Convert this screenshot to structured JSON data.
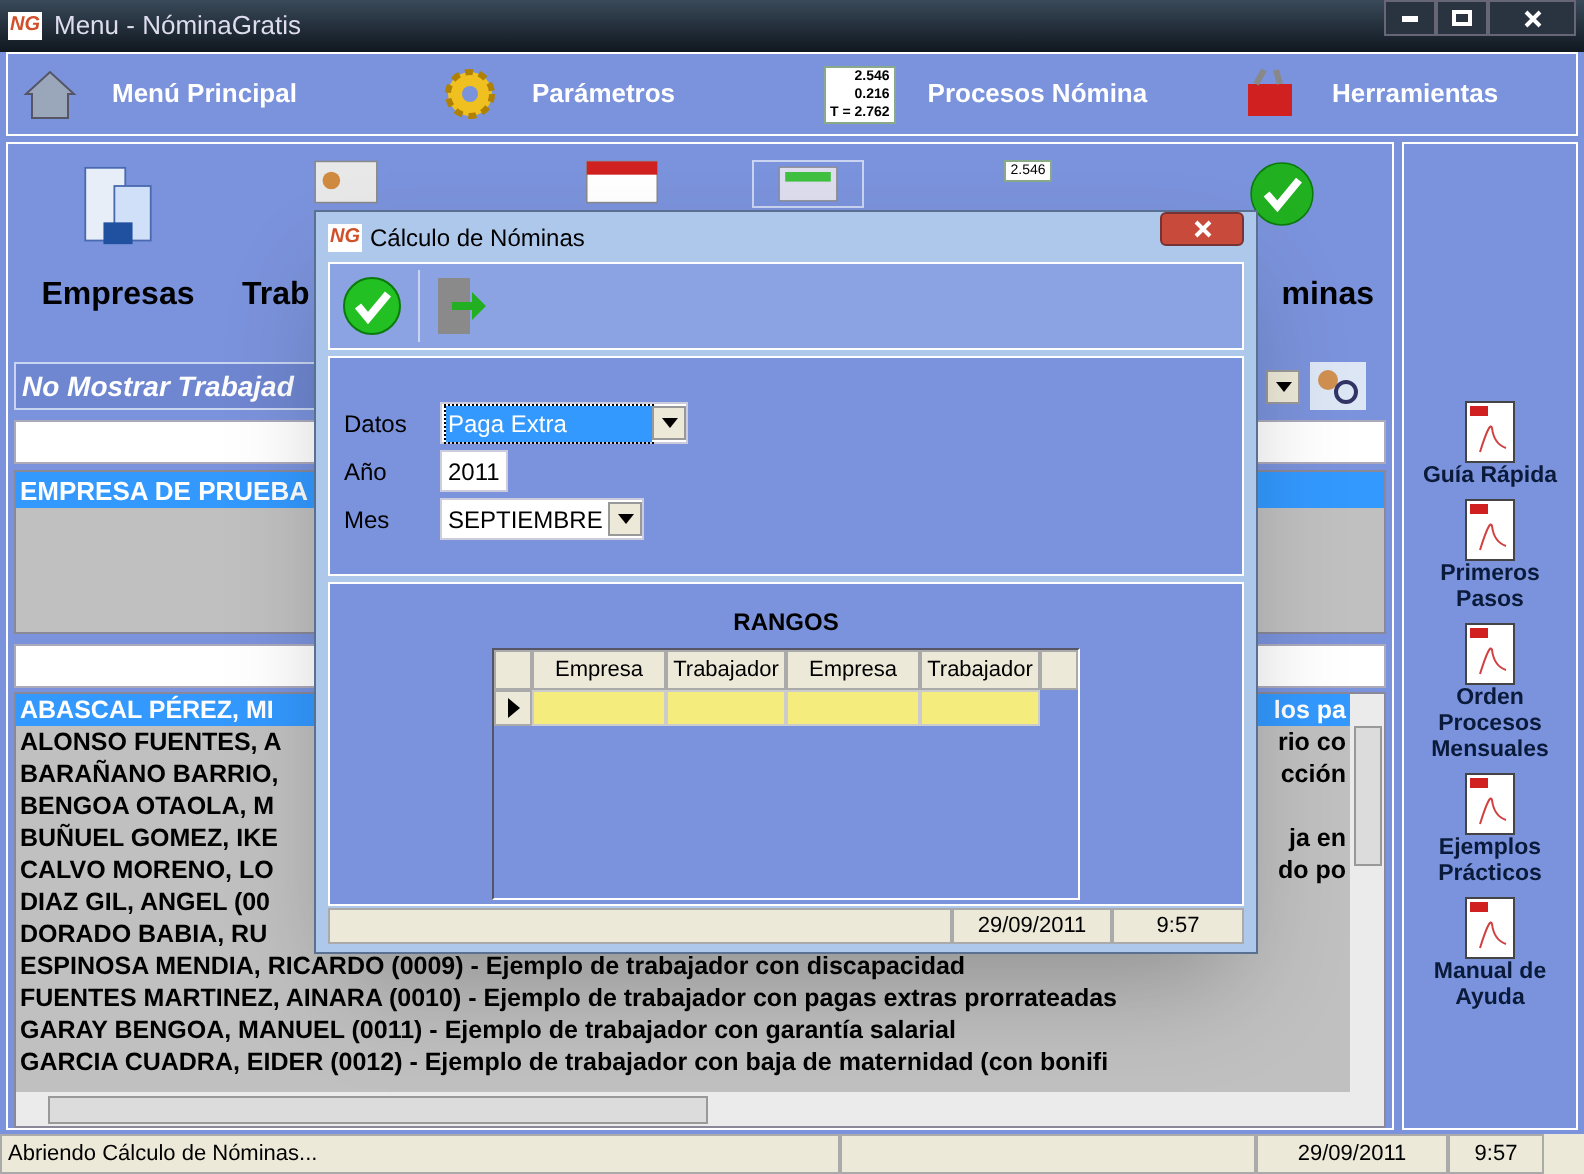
{
  "window": {
    "logo": "NG",
    "title": "Menu - NóminaGratis"
  },
  "menu": [
    {
      "kind": "home",
      "label": "Menú Principal"
    },
    {
      "kind": "gear",
      "label": "Parámetros"
    },
    {
      "kind": "sheet",
      "label": "Procesos Nómina",
      "icon_values": [
        "2.546",
        "0.216",
        "T = 2.762"
      ]
    },
    {
      "kind": "toolbox",
      "label": "Herramientas"
    }
  ],
  "modules": [
    {
      "kind": "building",
      "label": "Empresas"
    },
    {
      "kind": "card",
      "label": "Trab"
    },
    {
      "kind": "calendar"
    },
    {
      "kind": "calculator",
      "selected": true
    },
    {
      "kind": "sheet",
      "icon_value": "2.546"
    },
    {
      "kind": "check",
      "label": "minas"
    }
  ],
  "filter": {
    "value": "No Mostrar Trabajad"
  },
  "companies": [
    {
      "name": "EMPRESA DE PRUEBA",
      "selected": true
    }
  ],
  "workers": [
    {
      "left": "ABASCAL  PÉREZ, MI",
      "right": "los pa",
      "selected": true
    },
    {
      "left": "ALONSO  FUENTES, A",
      "right": "rio co",
      "selected": false
    },
    {
      "left": "BARAÑANO  BARRIO,",
      "right": "cción",
      "selected": false
    },
    {
      "left": "BENGOA  OTAOLA, M",
      "selected": false
    },
    {
      "left": "BUÑUEL  GOMEZ, IKE",
      "right": "ja en",
      "selected": false
    },
    {
      "left": "CALVO  MORENO, LO",
      "right": "do po",
      "selected": false
    },
    {
      "left": "DIAZ  GIL, ANGEL (00",
      "selected": false
    },
    {
      "left": "DORADO  BABIA, RU",
      "selected": false
    },
    {
      "left": "ESPINOSA  MENDIA, RICARDO (0009) - Ejemplo de trabajador con discapacidad",
      "selected": false
    },
    {
      "left": "FUENTES  MARTINEZ, AINARA (0010) - Ejemplo de trabajador con pagas extras prorrateadas",
      "selected": false
    },
    {
      "left": "GARAY  BENGOA, MANUEL (0011) - Ejemplo de trabajador con garantía salarial",
      "selected": false
    },
    {
      "left": "GARCIA  CUADRA, EIDER (0012) - Ejemplo de trabajador con baja de maternidad (con bonifi",
      "selected": false
    }
  ],
  "help_docs": [
    "Guía Rápida",
    "Primeros Pasos",
    "Orden Procesos Mensuales",
    "Ejemplos Prácticos",
    "Manual de Ayuda"
  ],
  "status_bar": {
    "message": "Abriendo Cálculo de Nóminas...",
    "date": "29/09/2011",
    "time": "9:57"
  },
  "dialog": {
    "logo": "NG",
    "title": "Cálculo de Nóminas",
    "fields": [
      {
        "kind": "dropdown",
        "label": "Datos",
        "value": "Paga Extra",
        "focused": true
      },
      {
        "kind": "text",
        "label": "Año",
        "value": "2011",
        "focused": false
      },
      {
        "kind": "dropdown",
        "label": "Mes",
        "value": "SEPTIEMBRE",
        "focused": false
      }
    ],
    "ranges": {
      "title": "RANGOS",
      "columns": [
        "Empresa",
        "Trabajador",
        "Empresa",
        "Trabajador"
      ],
      "rows": [
        {
          "selected": true
        }
      ]
    },
    "status_bar": {
      "date": "29/09/2011",
      "time": "9:57"
    }
  }
}
